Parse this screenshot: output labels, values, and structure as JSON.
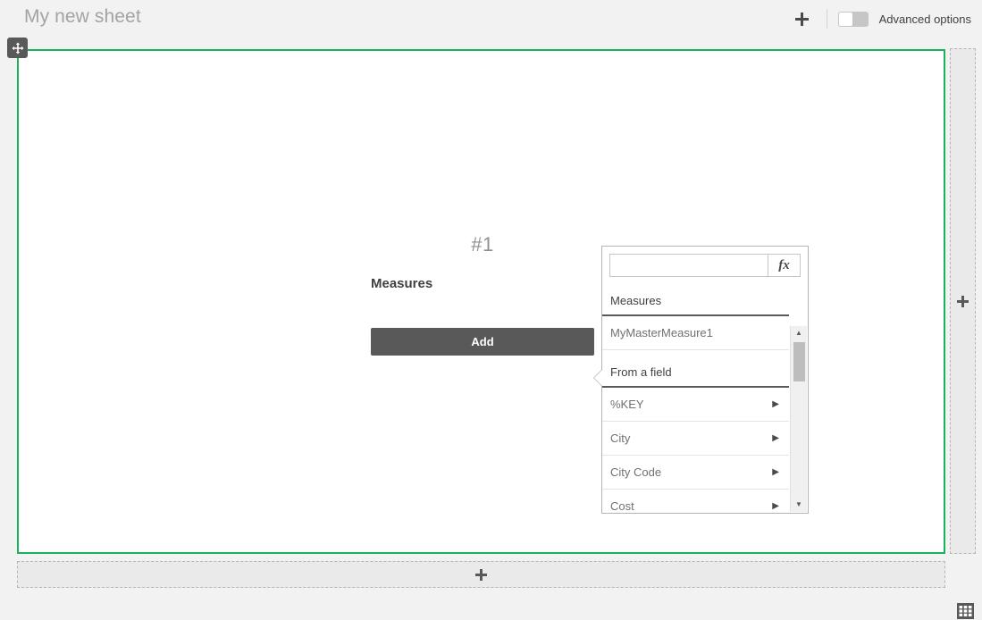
{
  "topbar": {
    "sheet_title": "My new sheet",
    "add_sheet_icon": "plus-icon",
    "advanced_options_label": "Advanced options",
    "advanced_options_state": "off"
  },
  "object": {
    "move_handle_icon": "move-icon",
    "number": "#1",
    "section_label": "Measures",
    "add_button_label": "Add",
    "selection_color": "#1ab25a"
  },
  "popover": {
    "search_value": "",
    "search_placeholder": "",
    "fx_button_label": "fx",
    "fx_icon": "expression-editor-icon",
    "sections": [
      {
        "header": "Measures",
        "items": [
          {
            "label": "MyMasterMeasure1",
            "has_submenu": false
          }
        ]
      },
      {
        "header": "From a field",
        "items": [
          {
            "label": "%KEY",
            "has_submenu": true
          },
          {
            "label": "City",
            "has_submenu": true
          },
          {
            "label": "City Code",
            "has_submenu": true
          },
          {
            "label": "Cost",
            "has_submenu": true
          }
        ]
      }
    ],
    "submenu_caret": "▶",
    "scrollbar": {
      "up_arrow": "▲",
      "down_arrow": "▼"
    }
  },
  "dropzones": {
    "right_icon": "plus-icon",
    "bottom_icon": "plus-icon"
  },
  "footer": {
    "grid_icon": "grid-layout-icon"
  }
}
